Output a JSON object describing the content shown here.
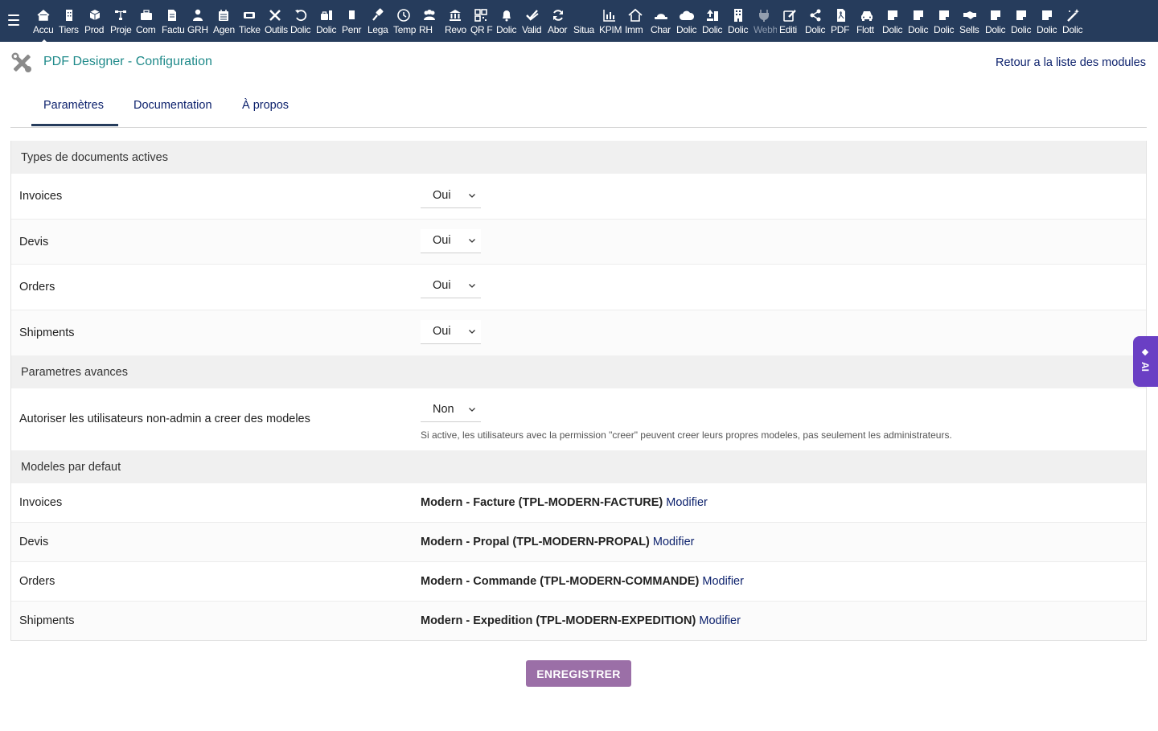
{
  "topbar": {
    "menu": [
      {
        "label": "Accu",
        "icon": "home-icon",
        "active": true
      },
      {
        "label": "Tiers",
        "icon": "building-icon"
      },
      {
        "label": "Prod",
        "icon": "cube-icon"
      },
      {
        "label": "Proje",
        "icon": "sitemap-icon"
      },
      {
        "label": "Com",
        "icon": "briefcase-icon"
      },
      {
        "label": "Factu",
        "icon": "invoice-icon"
      },
      {
        "label": "GRH",
        "icon": "user-tie-icon"
      },
      {
        "label": "Agen",
        "icon": "calendar-icon"
      },
      {
        "label": "Ticke",
        "icon": "ticket-icon"
      },
      {
        "label": "Outils",
        "icon": "tools-icon"
      },
      {
        "label": "Dolic",
        "icon": "undo-icon"
      },
      {
        "label": "Dolic",
        "icon": "bag-icon"
      },
      {
        "label": "Penr",
        "icon": "file-icon"
      },
      {
        "label": "Lega",
        "icon": "gavel-icon"
      },
      {
        "label": "Temp",
        "icon": "clock-icon"
      },
      {
        "label": "RH",
        "icon": "users-icon"
      },
      {
        "label": "Revo",
        "icon": "bank-icon"
      },
      {
        "label": "QR F",
        "icon": "qrcode-icon"
      },
      {
        "label": "Dolic",
        "icon": "bell-icon"
      },
      {
        "label": "Valid",
        "icon": "check-double-icon"
      },
      {
        "label": "Abor",
        "icon": "sync-icon"
      },
      {
        "label": "Situa",
        "icon": "blank-icon"
      },
      {
        "label": "KPIM",
        "icon": "chart-bar-icon"
      },
      {
        "label": "Imm",
        "icon": "house-icon"
      },
      {
        "label": "Char",
        "icon": "hat-icon"
      },
      {
        "label": "Dolic",
        "icon": "cloud-icon"
      },
      {
        "label": "Dolic",
        "icon": "upload-icon"
      },
      {
        "label": "Dolic",
        "icon": "office-building-icon"
      },
      {
        "label": "Webh",
        "icon": "plug-icon",
        "dim": true
      },
      {
        "label": "Editi",
        "icon": "edit-icon"
      },
      {
        "label": "Dolic",
        "icon": "share-icon"
      },
      {
        "label": "PDF",
        "icon": "pdf-file-icon"
      },
      {
        "label": "Flott",
        "icon": "car-icon"
      },
      {
        "label": "Dolic",
        "icon": "note-icon"
      },
      {
        "label": "Dolic",
        "icon": "note-icon"
      },
      {
        "label": "Dolic",
        "icon": "note-icon"
      },
      {
        "label": "Sells",
        "icon": "handshake-icon"
      },
      {
        "label": "Dolic",
        "icon": "note-icon"
      },
      {
        "label": "Dolic",
        "icon": "note-icon"
      },
      {
        "label": "Dolic",
        "icon": "note-icon"
      },
      {
        "label": "Dolic",
        "icon": "magic-wand-icon"
      }
    ]
  },
  "header": {
    "title": "PDF Designer - Configuration",
    "back_link": "Retour a la liste des modules"
  },
  "tabs": [
    {
      "label": "Paramètres",
      "active": true
    },
    {
      "label": "Documentation"
    },
    {
      "label": "À propos"
    }
  ],
  "sections": {
    "doc_types": {
      "title": "Types de documents actives",
      "rows": [
        {
          "label": "Invoices",
          "value": "Oui"
        },
        {
          "label": "Devis",
          "value": "Oui"
        },
        {
          "label": "Orders",
          "value": "Oui"
        },
        {
          "label": "Shipments",
          "value": "Oui"
        }
      ]
    },
    "advanced": {
      "title": "Parametres avances",
      "row": {
        "label": "Autoriser les utilisateurs non-admin a creer des modeles",
        "value": "Non",
        "note": "Si active, les utilisateurs avec la permission \"creer\" peuvent creer leurs propres modeles, pas seulement les administrateurs."
      }
    },
    "defaults": {
      "title": "Modeles par defaut",
      "rows": [
        {
          "label": "Invoices",
          "template": "Modern - Facture (TPL-MODERN-FACTURE)",
          "link": "Modifier"
        },
        {
          "label": "Devis",
          "template": "Modern - Propal (TPL-MODERN-PROPAL)",
          "link": "Modifier"
        },
        {
          "label": "Orders",
          "template": "Modern - Commande (TPL-MODERN-COMMANDE)",
          "link": "Modifier"
        },
        {
          "label": "Shipments",
          "template": "Modern - Expedition (TPL-MODERN-EXPEDITION)",
          "link": "Modifier"
        }
      ]
    }
  },
  "save_button": "ENREGISTRER",
  "ai_tab": "AI",
  "colors": {
    "topbar": "#263c5c",
    "title": "#1f8a8a",
    "link": "#0a1f6b",
    "button": "#9b6fa7",
    "ai_tab": "#6a3fc4"
  }
}
